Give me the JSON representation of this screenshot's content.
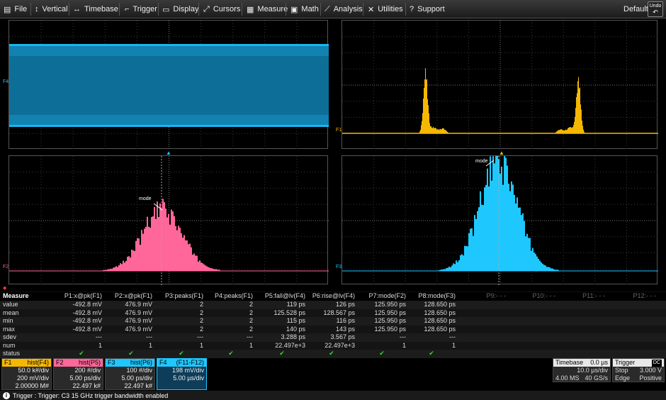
{
  "menu": {
    "file": "File",
    "vertical": "Vertical",
    "timebase": "Timebase",
    "trigger": "Trigger",
    "display": "Display",
    "cursors": "Cursors",
    "measure": "Measure",
    "math": "Math",
    "analysis": "Analysis",
    "utilities": "Utilities",
    "support": "Support",
    "default_label": "Default",
    "undo_label": "Undo"
  },
  "markers": {
    "f4": "F4",
    "f1": "F1",
    "f2": "F2",
    "f3": "F3",
    "mode": "mode"
  },
  "measure": {
    "header": [
      "Measure",
      "P1:x@pk(F1)",
      "P2:x@pk(F1)",
      "P3:peaks(F1)",
      "P4:peaks(F1)",
      "P5:fall@lv(F4)",
      "P6:rise@lv(F4)",
      "P7:mode(F2)",
      "P8:mode(F3)",
      "P9:- - -",
      "P10:- - -",
      "P11:- - -",
      "P12:- - -"
    ],
    "rows": [
      {
        "label": "value",
        "cells": [
          "-492.8 mV",
          "476.9 mV",
          "2",
          "2",
          "119 ps",
          "126 ps",
          "125.950 ps",
          "128.650 ps"
        ]
      },
      {
        "label": "mean",
        "cells": [
          "-492.8 mV",
          "476.9 mV",
          "2",
          "2",
          "125.528 ps",
          "128.567 ps",
          "125.950 ps",
          "128.650 ps"
        ]
      },
      {
        "label": "min",
        "cells": [
          "-492.8 mV",
          "476.9 mV",
          "2",
          "2",
          "115 ps",
          "116 ps",
          "125.950 ps",
          "128.650 ps"
        ]
      },
      {
        "label": "max",
        "cells": [
          "-492.8 mV",
          "476.9 mV",
          "2",
          "2",
          "140 ps",
          "143 ps",
          "125.950 ps",
          "128.650 ps"
        ]
      },
      {
        "label": "sdev",
        "cells": [
          "---",
          "---",
          "---",
          "---",
          "3.288 ps",
          "3.567 ps",
          "---",
          "---"
        ]
      },
      {
        "label": "num",
        "cells": [
          "1",
          "1",
          "1",
          "1",
          "22.497e+3",
          "22.497e+3",
          "1",
          "1"
        ]
      },
      {
        "label": "status",
        "cells": [
          "✔",
          "✔",
          "✔",
          "✔",
          "✔",
          "✔",
          "✔",
          "✔"
        ]
      }
    ]
  },
  "descriptors": [
    {
      "name": "F1",
      "fn": "hist(F4)",
      "color": "#f5b800",
      "lines": [
        "50.0 k#/div",
        "200 mV/div",
        "2.00000 M#"
      ]
    },
    {
      "name": "F2",
      "fn": "hist(P5)",
      "color": "#ff6699",
      "lines": [
        "200 #/div",
        "5.00 ps/div",
        "22.497 k#"
      ]
    },
    {
      "name": "F3",
      "fn": "hist(P6)",
      "color": "#1ec8ff",
      "lines": [
        "100 #/div",
        "5.00 ps/div",
        "22.497 k#"
      ]
    },
    {
      "name": "F4",
      "fn": "(F11-F12)",
      "color": "#1ec8ff",
      "lines": [
        "198 mV/div",
        "5.00 µs/div",
        ""
      ]
    }
  ],
  "timebase": {
    "label": "Timebase",
    "delay": "0.0 µs",
    "per_div": "10.0 µs/div",
    "samples": "4.00 MS",
    "rate": "40 GS/s"
  },
  "trigger": {
    "label": "Trigger",
    "coupling": "DC",
    "mode": "Stop",
    "level": "3.000 V",
    "type": "Edge",
    "slope": "Positive"
  },
  "status": {
    "text": "Trigger : Trigger: C3 15 GHz trigger bandwidth enabled"
  },
  "colors": {
    "f1": "#f5b800",
    "f2": "#ff6699",
    "f3": "#1ec8ff",
    "f4": "#1ec8ff"
  }
}
